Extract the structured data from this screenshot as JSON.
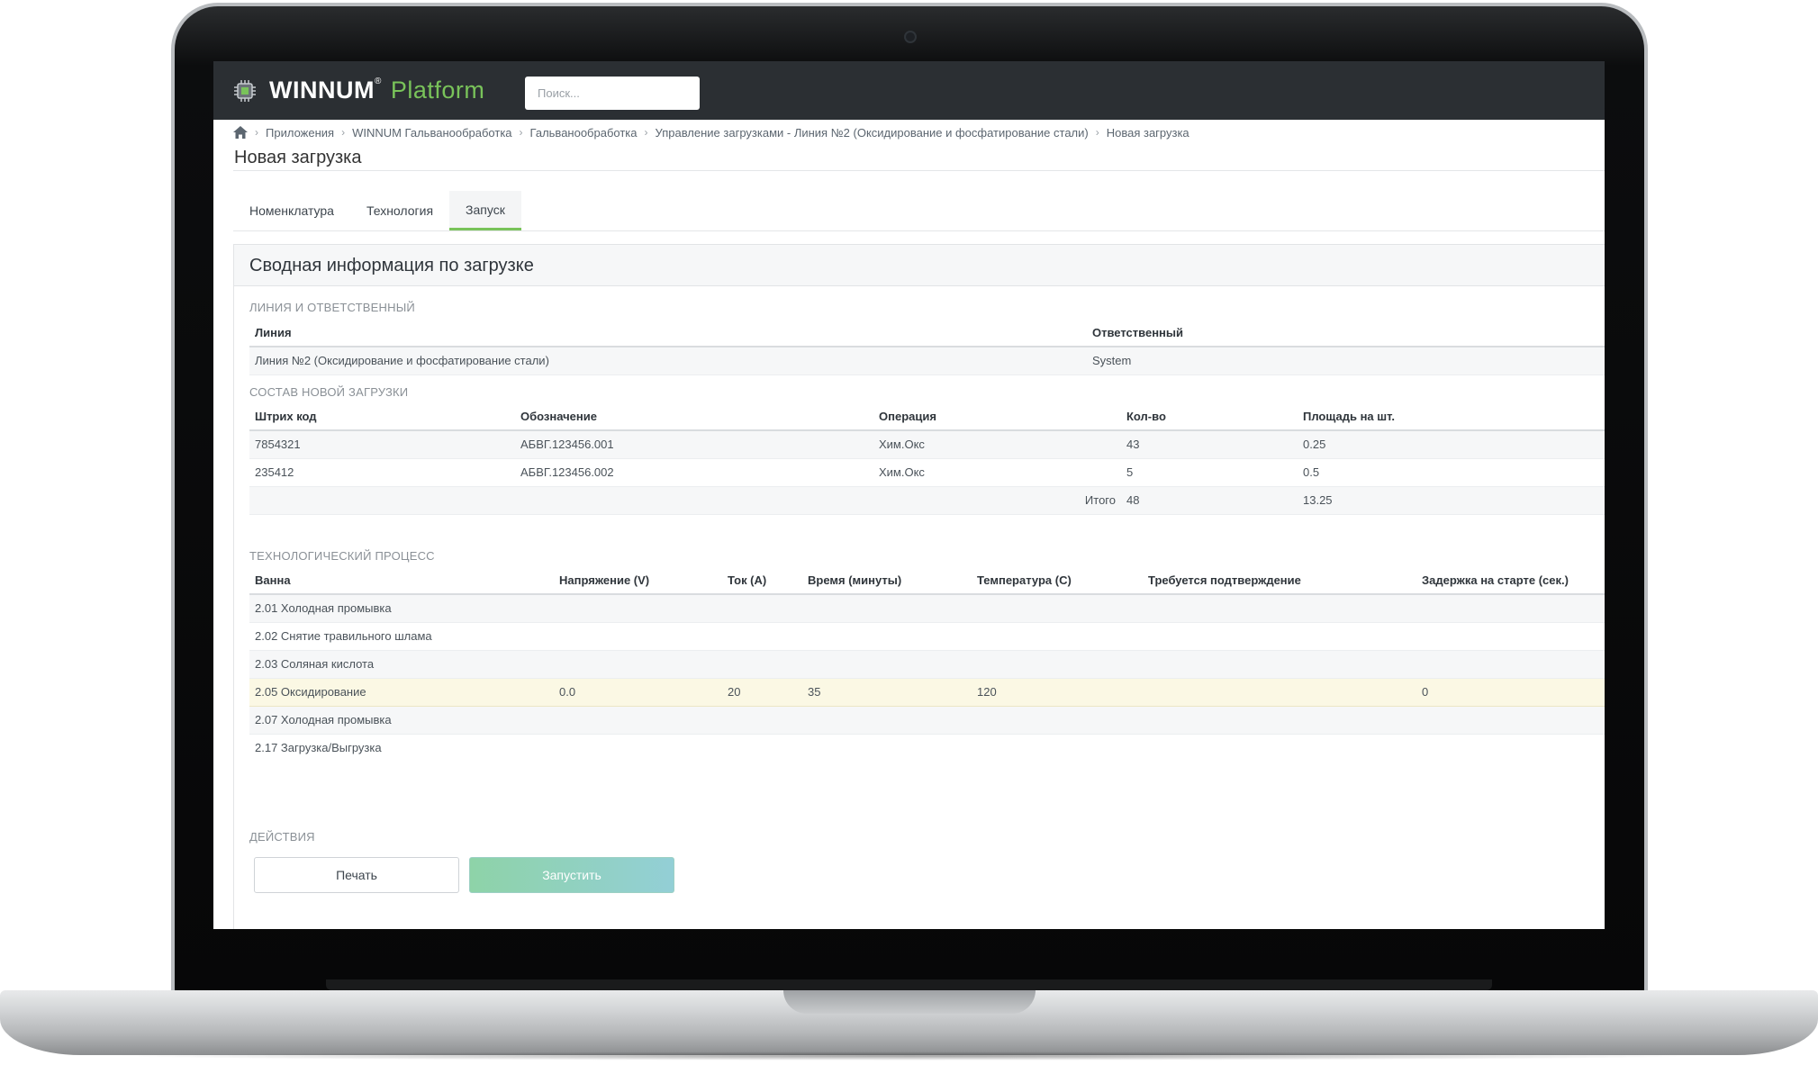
{
  "app": {
    "brand": "WINNUM",
    "brand_reg": "®",
    "brand_suffix": "Platform",
    "search_placeholder": "Поиск..."
  },
  "breadcrumb": [
    "Приложения",
    "WINNUM Гальванообработка",
    "Гальванообработка",
    "Управление загрузками - Линия №2 (Оксидирование и фосфатирование стали)",
    "Новая загрузка"
  ],
  "page_title": "Новая загрузка",
  "tabs": [
    {
      "label": "Номенклатура",
      "active": false
    },
    {
      "label": "Технология",
      "active": false
    },
    {
      "label": "Запуск",
      "active": true
    }
  ],
  "panel_title": "Сводная информация по загрузке",
  "line_section": {
    "label": "ЛИНИЯ И ОТВЕТСТВЕННЫЙ",
    "headers": [
      "Линия",
      "Ответственный"
    ],
    "row": [
      "Линия №2 (Оксидирование и фосфатирование стали)",
      "System"
    ]
  },
  "composition_section": {
    "label": "СОСТАВ НОВОЙ ЗАГРУЗКИ",
    "headers": [
      "Штрих код",
      "Обозначение",
      "Операция",
      "Кол-во",
      "Площадь на шт."
    ],
    "rows": [
      [
        "7854321",
        "АБВГ.123456.001",
        "Хим.Окс",
        "43",
        "0.25"
      ],
      [
        "235412",
        "АБВГ.123456.002",
        "Хим.Окс",
        "5",
        "0.5"
      ]
    ],
    "total_label": "Итого",
    "total_qty": "48",
    "total_area": "13.25"
  },
  "process_section": {
    "label": "ТЕХНОЛОГИЧЕСКИЙ ПРОЦЕСС",
    "headers": [
      "Ванна",
      "Напряжение (V)",
      "Ток (А)",
      "Время (минуты)",
      "Температура (С)",
      "Требуется подтверждение",
      "Задержка на старте (сек.)"
    ],
    "rows": [
      [
        "2.01 Холодная промывка",
        "",
        "",
        "",
        "",
        "",
        ""
      ],
      [
        "2.02 Снятие травильного шлама",
        "",
        "",
        "",
        "",
        "",
        ""
      ],
      [
        "2.03 Соляная кислота",
        "",
        "",
        "",
        "",
        "",
        ""
      ],
      [
        "2.05 Оксидирование",
        "0.0",
        "20",
        "35",
        "120",
        "",
        "0"
      ],
      [
        "2.07 Холодная промывка",
        "",
        "",
        "",
        "",
        "",
        ""
      ],
      [
        "2.17 Загрузка/Выгрузка",
        "",
        "",
        "",
        "",
        "",
        ""
      ]
    ]
  },
  "actions_section": {
    "label": "ДЕЙСТВИЯ",
    "print_label": "Печать",
    "run_label": "Запустить"
  },
  "colors": {
    "topbar": "#2b2f33",
    "accent_green": "#79c35a",
    "highlight_row": "#fbf8e4"
  }
}
